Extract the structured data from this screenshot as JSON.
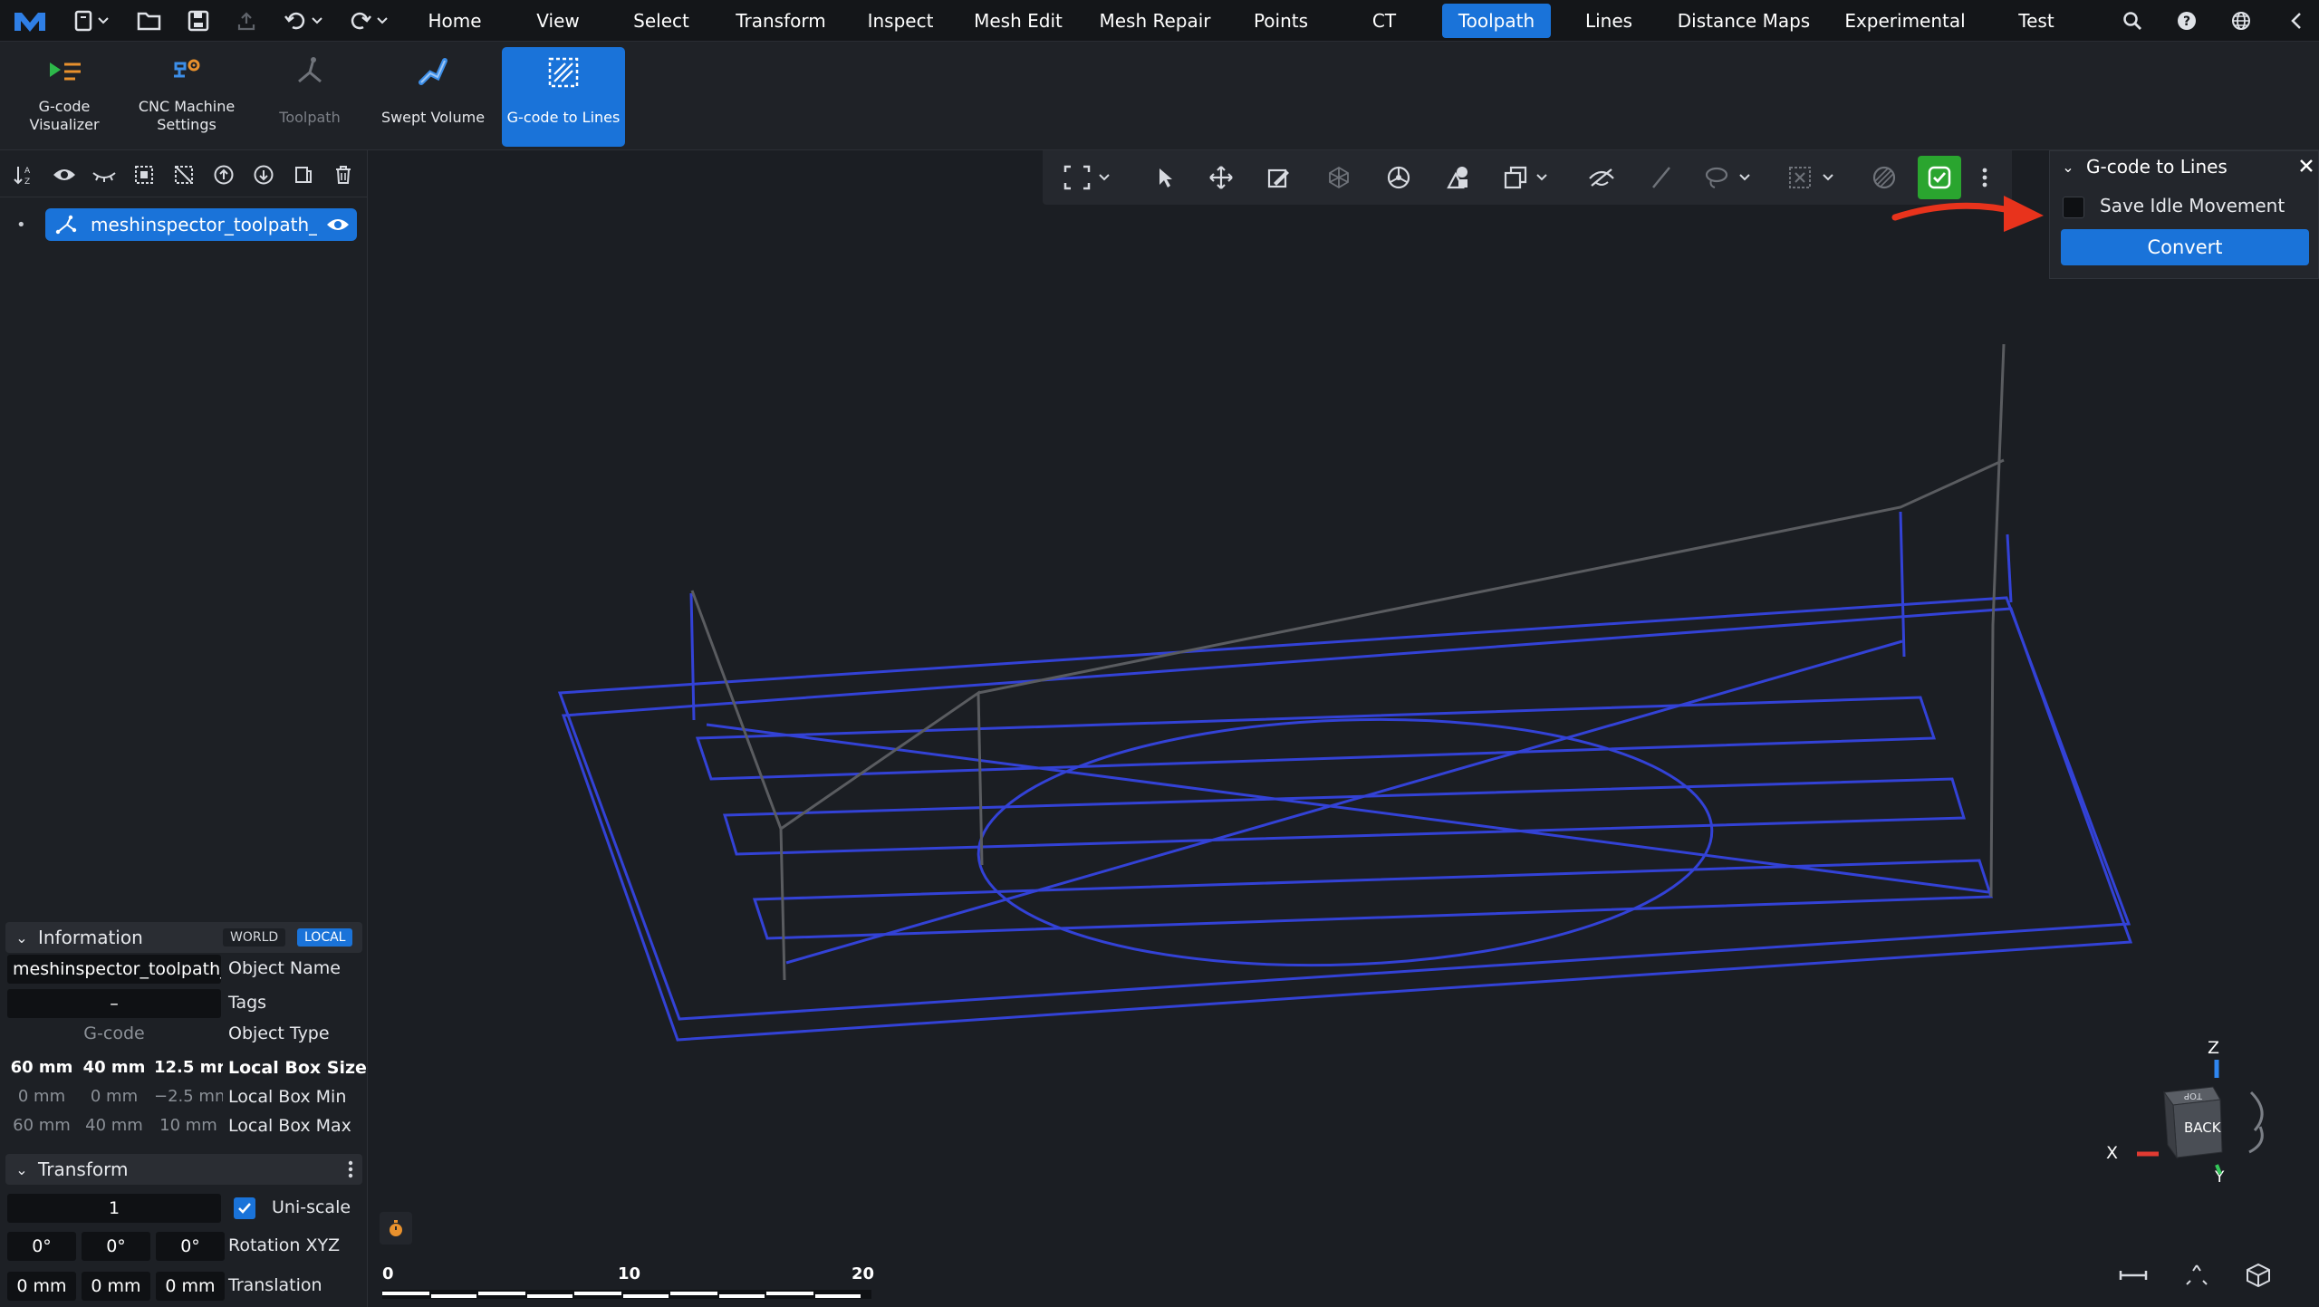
{
  "menubar": {
    "tabs": [
      {
        "label": "Home",
        "active": false
      },
      {
        "label": "View",
        "active": false
      },
      {
        "label": "Select",
        "active": false
      },
      {
        "label": "Transform",
        "active": false
      },
      {
        "label": "Inspect",
        "active": false
      },
      {
        "label": "Mesh Edit",
        "active": false
      },
      {
        "label": "Mesh Repair",
        "active": false
      },
      {
        "label": "Points",
        "active": false
      },
      {
        "label": "CT",
        "active": false
      },
      {
        "label": "Toolpath",
        "active": true
      },
      {
        "label": "Lines",
        "active": false
      },
      {
        "label": "Distance Maps",
        "active": false
      },
      {
        "label": "Experimental",
        "active": false
      },
      {
        "label": "Test",
        "active": false
      }
    ]
  },
  "ribbon": {
    "gcode_visualizer": "G-code\nVisualizer",
    "cnc_settings": "CNC Machine\nSettings",
    "toolpath": "Toolpath",
    "swept_volume": "Swept Volume",
    "gcode_to_lines": "G-code to Lines"
  },
  "scene": {
    "object_name": "meshinspector_toolpath_de"
  },
  "information": {
    "title": "Information",
    "world": "WORLD",
    "local": "LOCAL",
    "object_name_value": "meshinspector_toolpath_",
    "object_name_label": "Object Name",
    "tags_value": "–",
    "tags_label": "Tags",
    "type_value": "G-code",
    "type_label": "Object Type",
    "box_size": [
      "60 mm",
      "40 mm",
      "12.5 mr"
    ],
    "box_size_label": "Local Box Size",
    "box_min": [
      "0 mm",
      "0 mm",
      "−2.5 mn"
    ],
    "box_min_label": "Local Box Min",
    "box_max": [
      "60 mm",
      "40 mm",
      "10 mm"
    ],
    "box_max_label": "Local Box Max"
  },
  "transform": {
    "title": "Transform",
    "scale_value": "1",
    "uniscale_label": "Uni-scale",
    "rotation": [
      "0°",
      "0°",
      "0°"
    ],
    "rotation_label": "Rotation XYZ",
    "translation": [
      "0 mm",
      "0 mm",
      "0 mm"
    ],
    "translation_label": "Translation"
  },
  "gcode_panel": {
    "title": "G-code to Lines",
    "save_idle_label": "Save Idle Movement",
    "convert_label": "Convert"
  },
  "ruler": {
    "labels": [
      "0",
      "10",
      "20"
    ]
  },
  "viewcube": {
    "z": "Z",
    "x": "X",
    "y": "Y",
    "face_front": "BACK",
    "face_top": "TOP"
  },
  "colors": {
    "accent": "#1a73d9",
    "toolpath_line": "#3342d6",
    "idle_line": "#5a5c60",
    "arrow": "#e8331c"
  }
}
